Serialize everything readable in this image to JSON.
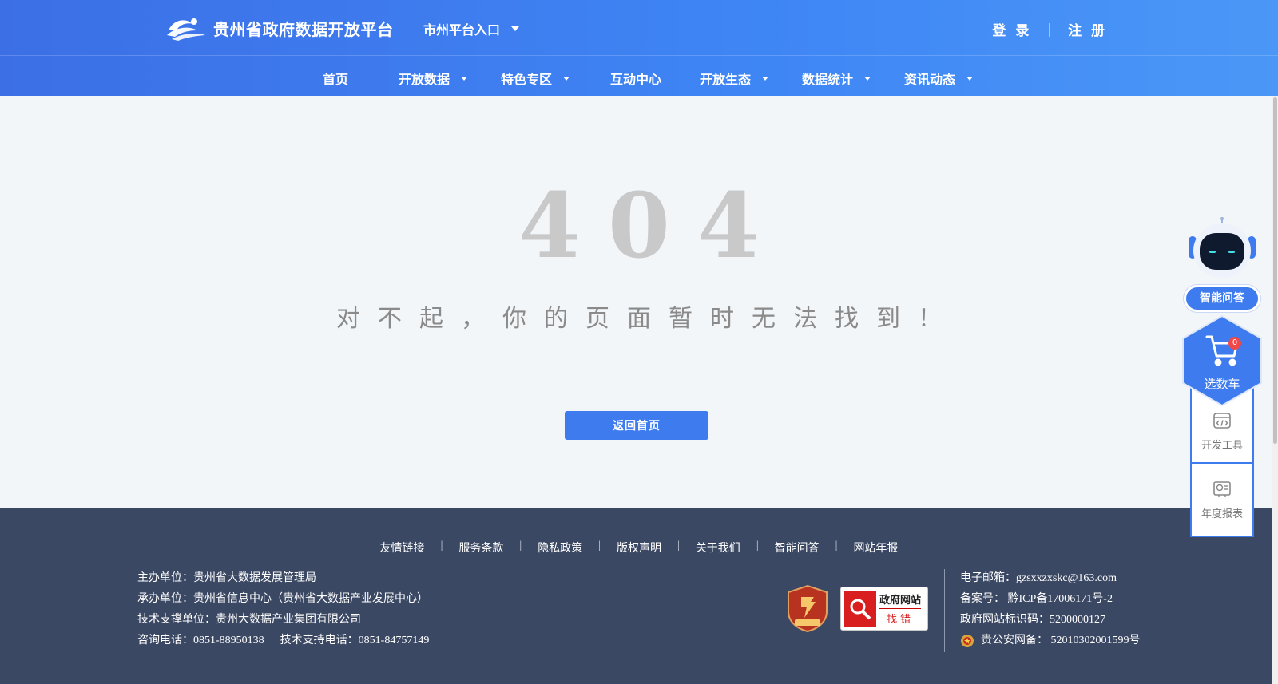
{
  "header": {
    "site_title": "贵州省政府数据开放平台",
    "city_entry": "市州平台入口",
    "login": "登 录",
    "register": "注 册",
    "auth_separator": "|"
  },
  "nav": {
    "items": [
      {
        "label": "首页"
      },
      {
        "label": "开放数据"
      },
      {
        "label": "特色专区"
      },
      {
        "label": "互动中心"
      },
      {
        "label": "开放生态"
      },
      {
        "label": "数据统计"
      },
      {
        "label": "资讯动态"
      }
    ]
  },
  "error": {
    "code": "404",
    "message": "对不起，你的页面暂时无法找到！",
    "home_button": "返回首页"
  },
  "widgets": {
    "ai_label": "智能问答",
    "cart_label": "选数车",
    "cart_count": "0",
    "dev_tools": "开发工具",
    "annual_report": "年度报表"
  },
  "footer": {
    "links": [
      "友情链接",
      "服务条款",
      "隐私政策",
      "版权声明",
      "关于我们",
      "智能问答",
      "网站年报"
    ],
    "link_separator": "|",
    "host": "主办单位：贵州省大数据发展管理局",
    "organizer": "承办单位：贵州省信息中心（贵州省大数据产业发展中心）",
    "tech_support": "技术支撑单位：贵州大数据产业集团有限公司",
    "phone": "咨询电话：0851-88950138",
    "tech_phone": "技术支持电话：0851-84757149",
    "badge_gov_line1": "政府网站",
    "badge_gov_line2": "找错",
    "email": "电子邮箱：gzsxxzxskc@163.com",
    "icp": "备案号： 黔ICP备17006171号-2",
    "gov_id": "政府网站标识码：5200000127",
    "police": "贵公安网备： 52010302001599号"
  },
  "colors": {
    "primary": "#3e7bef",
    "header_gradient_start": "#3c6fe6",
    "header_gradient_end": "#4a97f7",
    "footer_bg": "#3b4863",
    "page_bg": "#f3f6f9",
    "code_color": "#c9c9c9"
  },
  "icons": [
    "logo-cloud-icon",
    "caret-down-icon",
    "robot-icon",
    "cart-icon",
    "code-icon",
    "report-icon",
    "party-badge-icon",
    "magnifier-icon",
    "police-emblem-icon"
  ]
}
